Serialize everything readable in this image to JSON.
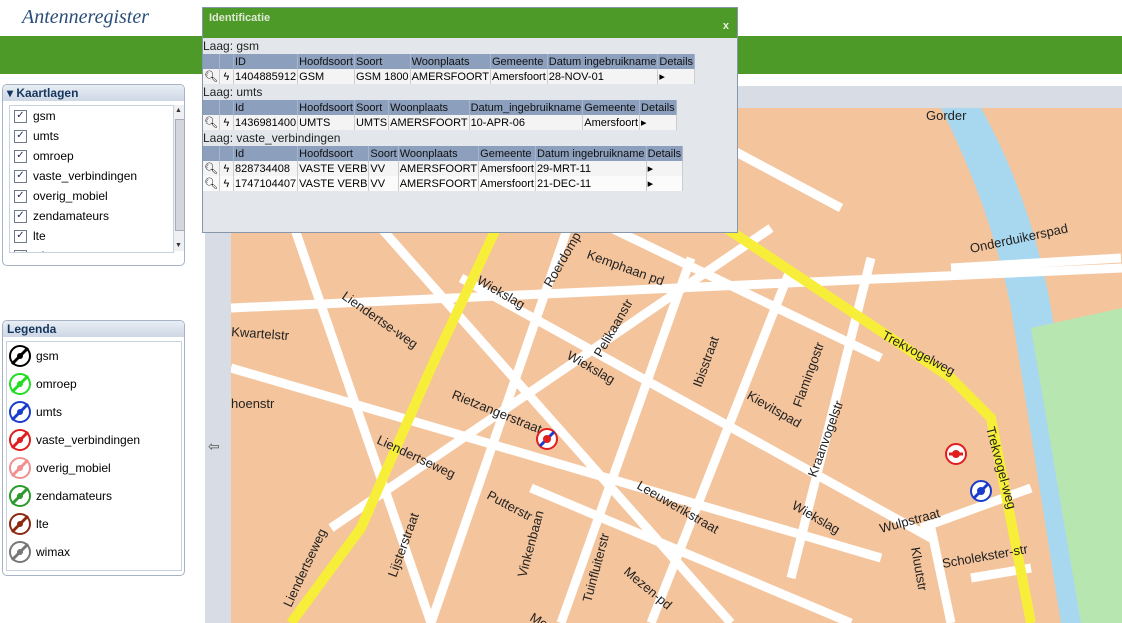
{
  "app": {
    "title": "Antenneregister"
  },
  "layers_panel": {
    "title": "Kaartlagen",
    "items": [
      {
        "label": "gsm",
        "checked": true
      },
      {
        "label": "umts",
        "checked": true
      },
      {
        "label": "omroep",
        "checked": true
      },
      {
        "label": "vaste_verbindingen",
        "checked": true
      },
      {
        "label": "overig_mobiel",
        "checked": true
      },
      {
        "label": "zendamateurs",
        "checked": true
      },
      {
        "label": "lte",
        "checked": true
      },
      {
        "label": "wimax",
        "checked": true
      }
    ]
  },
  "legend_panel": {
    "title": "Legenda",
    "items": [
      {
        "label": "gsm",
        "color": "#000000"
      },
      {
        "label": "omroep",
        "color": "#22dd22"
      },
      {
        "label": "umts",
        "color": "#1a3ccc"
      },
      {
        "label": "vaste_verbindingen",
        "color": "#e01e1e"
      },
      {
        "label": "overig_mobiel",
        "color": "#f09090"
      },
      {
        "label": "zendamateurs",
        "color": "#2a9a2a"
      },
      {
        "label": "lte",
        "color": "#8b2a10"
      },
      {
        "label": "wimax",
        "color": "#777777"
      }
    ]
  },
  "identificatie": {
    "title": "Identificatie",
    "close": "x",
    "sections": [
      {
        "laag": "Laag: gsm",
        "columns": [
          "ID",
          "Hoofdsoort",
          "Soort",
          "Woonplaats",
          "Gemeente",
          "Datum ingebruikname",
          "Details"
        ],
        "rows": [
          [
            "1404885912",
            "GSM",
            "GSM 1800",
            "AMERSFOORT",
            "Amersfoort",
            "28-NOV-01",
            "▸"
          ]
        ]
      },
      {
        "laag": "Laag: umts",
        "columns": [
          "Id",
          "Hoofdsoort",
          "Soort",
          "Woonplaats",
          "Datum_ingebruikname",
          "Gemeente",
          "Details"
        ],
        "rows": [
          [
            "1436981400",
            "UMTS",
            "UMTS",
            "AMERSFOORT",
            "10-APR-06",
            "Amersfoort",
            "▸"
          ]
        ]
      },
      {
        "laag": "Laag: vaste_verbindingen",
        "columns": [
          "Id",
          "Hoofdsoort",
          "Soort",
          "Woonplaats",
          "Gemeente",
          "Datum ingebruikname",
          "Details"
        ],
        "rows": [
          [
            "828734408",
            "VASTE VERB",
            "VV",
            "AMERSFOORT",
            "Amersfoort",
            "29-MRT-11",
            "▸"
          ],
          [
            "1747104407",
            "VASTE VERB",
            "VV",
            "AMERSFOORT",
            "Amersfoort",
            "21-DEC-11",
            "▸"
          ]
        ]
      }
    ]
  },
  "map": {
    "collapse_icon": "⇦",
    "streets": [
      "Gorder",
      "Onderduikerspad",
      "Kwartelstr",
      "Liendertse-weg",
      "Wiekslag",
      "Wiekslag",
      "Pelikaanstr",
      "Roerdomp",
      "Kemphaan pd",
      "Ibisstraat",
      "Flamingostr",
      "Kievitspad",
      "Kraanvogelstr",
      "Trekvogelweg",
      "Trekvogel-weg",
      "Rietzangerstraat",
      "Liendertseweg",
      "Putterstr",
      "Vinkenbaan",
      "Leeuwerikstraat",
      "Wulpstraat",
      "Wiekslag",
      "Liendertseweg",
      "Lijsterstraat",
      "Tuinfluiterstr",
      "Mezen-pd",
      "Scholekster-str",
      "Kluutstr",
      "hoenstr",
      "Merel"
    ]
  }
}
